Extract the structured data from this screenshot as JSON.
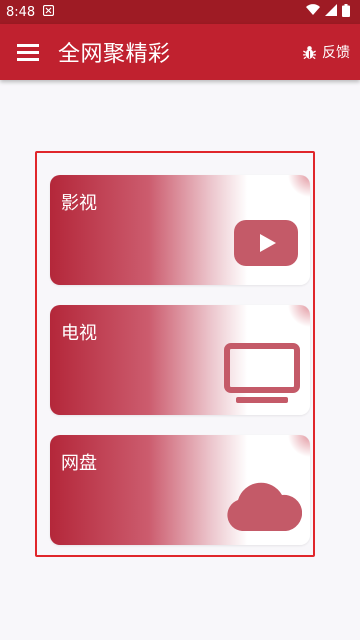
{
  "status_bar": {
    "time": "8:48"
  },
  "app_bar": {
    "title": "全网聚精彩",
    "feedback_label": "反馈"
  },
  "cards": [
    {
      "label": "影视",
      "icon": "play-video-icon"
    },
    {
      "label": "电视",
      "icon": "tv-icon"
    },
    {
      "label": "网盘",
      "icon": "cloud-icon"
    }
  ],
  "colors": {
    "status_bar": "#9e1b24",
    "app_bar": "#c0212f",
    "card_accent": "#b4273a",
    "icon": "#c45a68",
    "frame": "#e0262b"
  }
}
